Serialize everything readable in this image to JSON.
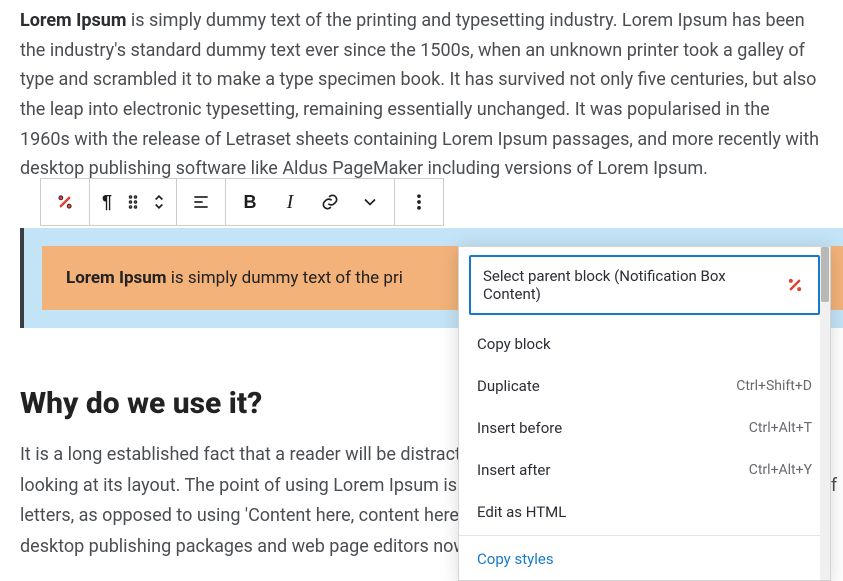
{
  "para1": {
    "bold": "Lorem Ipsum",
    "rest": " is simply dummy text of the printing and typesetting industry. Lorem Ipsum has been the industry's standard dummy text ever since the 1500s, when an unknown printer took a galley of type and scrambled it to make a type specimen book. It has survived not only five centuries, but also the leap into electronic typesetting, remaining essentially unchanged. It was popularised in the 1960s with the release of Letraset sheets containing Lorem Ipsum passages, and more recently with desktop publishing software like Aldus PageMaker including versions of Lorem Ipsum."
  },
  "notif": {
    "bold": "Lorem Ipsum",
    "rest": " is simply dummy text of the pri"
  },
  "heading": "Why do we use it?",
  "para2": "It is a long established fact that a reader will be distracted by the readable content of a page when looking at its layout. The point of using Lorem Ipsum is that it has a more-or-less normal distribution of letters, as opposed to using 'Content here, content here', making it look like readable English. Many desktop publishing packages and web page editors now use Lorem Ipsum as their default model text.",
  "dropdown": {
    "parent": "Select parent block (Notification Box Content)",
    "copy_block": "Copy block",
    "duplicate": "Duplicate",
    "duplicate_kbd": "Ctrl+Shift+D",
    "insert_before": "Insert before",
    "insert_before_kbd": "Ctrl+Alt+T",
    "insert_after": "Insert after",
    "insert_after_kbd": "Ctrl+Alt+Y",
    "edit_html": "Edit as HTML",
    "copy_styles": "Copy styles"
  },
  "toolbar": {
    "block_icon": "notification-block-icon",
    "paragraph": "¶",
    "bold": "B",
    "italic": "I"
  }
}
